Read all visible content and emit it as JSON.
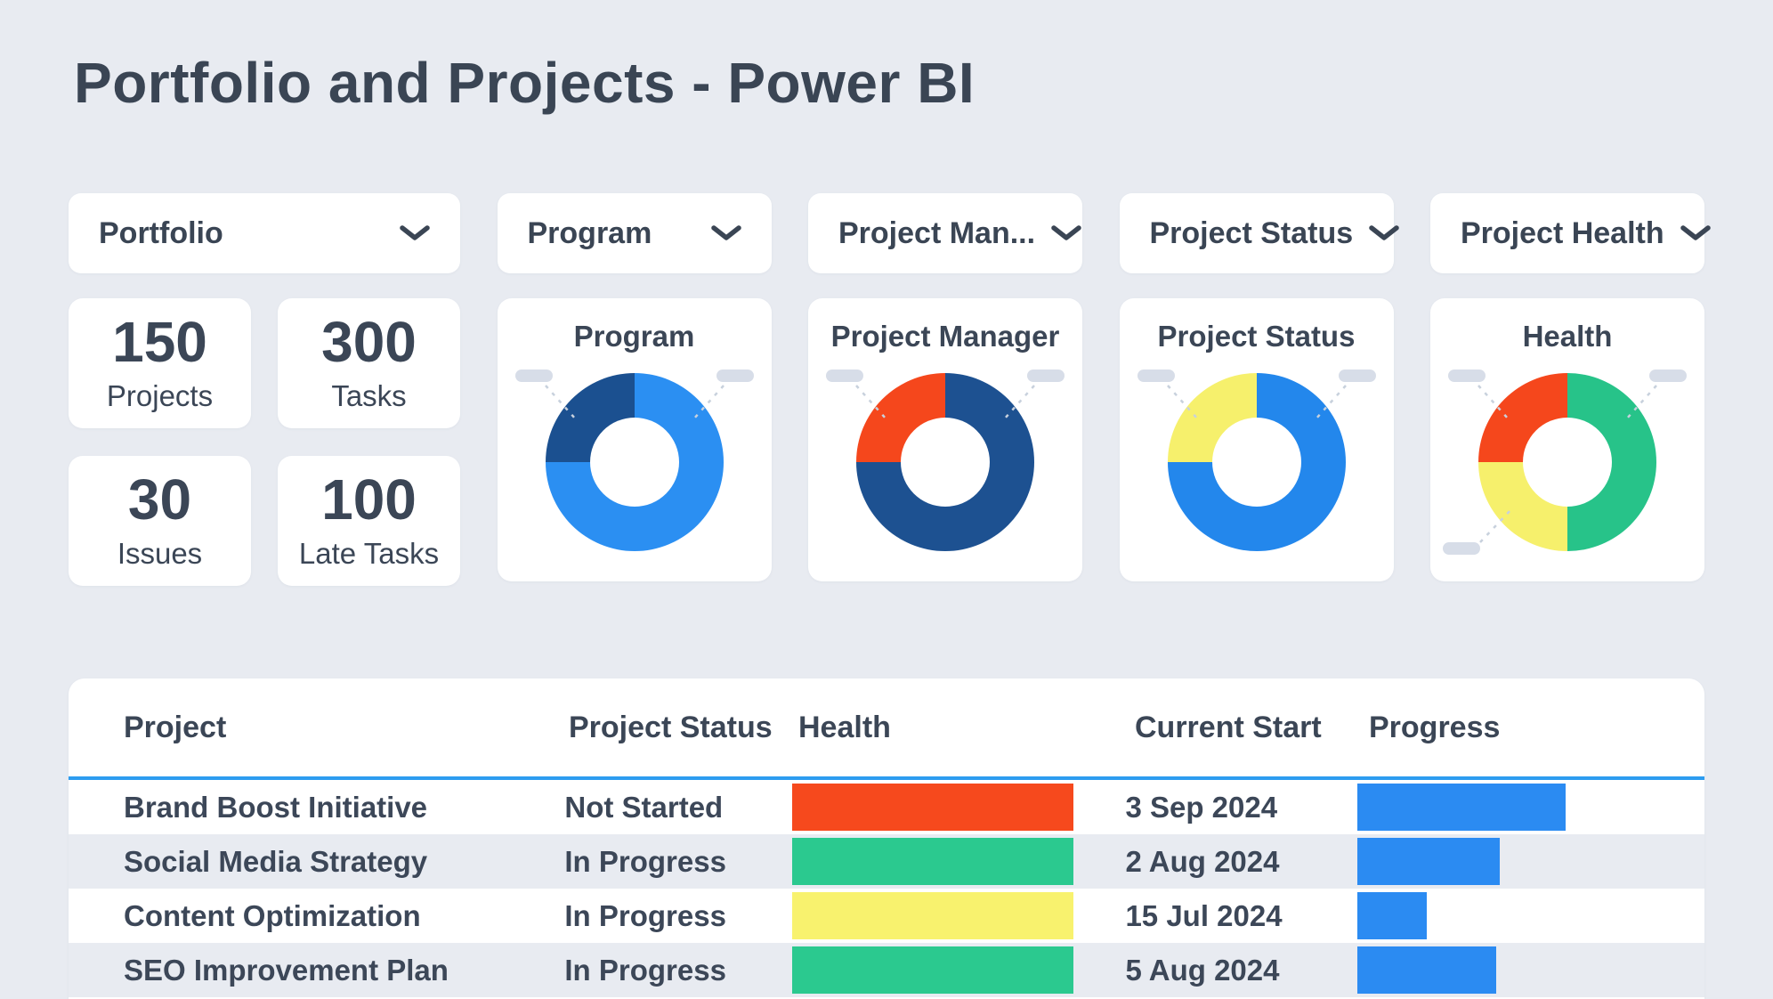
{
  "page": {
    "title": "Portfolio and Projects - Power BI",
    "background": "#E8EBF1"
  },
  "filters": [
    {
      "label": "Portfolio"
    },
    {
      "label": "Program"
    },
    {
      "label": "Project Man..."
    },
    {
      "label": "Project Status"
    },
    {
      "label": "Project Health"
    }
  ],
  "kpis": [
    {
      "value": "150",
      "label": "Projects"
    },
    {
      "value": "300",
      "label": "Tasks"
    },
    {
      "value": "30",
      "label": "Issues"
    },
    {
      "value": "100",
      "label": "Late Tasks"
    }
  ],
  "donuts": [
    {
      "title": "Program",
      "segments": [
        {
          "color": "#2B8FF2",
          "degrees": 270
        },
        {
          "color": "#1B5090",
          "degrees": 90
        }
      ],
      "callouts": [
        "top-left",
        "top-right"
      ]
    },
    {
      "title": "Project Manager",
      "segments": [
        {
          "color": "#1D5191",
          "degrees": 270
        },
        {
          "color": "#F5471C",
          "degrees": 90
        }
      ],
      "callouts": [
        "top-left",
        "top-right"
      ]
    },
    {
      "title": "Project Status",
      "segments": [
        {
          "color": "#2387EC",
          "degrees": 270
        },
        {
          "color": "#F6F06C",
          "degrees": 90
        }
      ],
      "callouts": [
        "top-left",
        "top-right"
      ]
    },
    {
      "title": "Health",
      "segments": [
        {
          "color": "#27C389",
          "degrees": 180
        },
        {
          "color": "#F6F06C",
          "degrees": 90
        },
        {
          "color": "#F5471C",
          "degrees": 90
        }
      ],
      "callouts": [
        "top-left",
        "top-right",
        "bottom-left"
      ]
    }
  ],
  "table": {
    "columns": [
      "Project",
      "Project Status",
      "Health",
      "Current Start",
      "Progress"
    ],
    "divider_color": "#2D9CF0",
    "progress_color": "#2B8BF2",
    "rows": [
      {
        "project": "Brand Boost Initiative",
        "status": "Not Started",
        "health_color": "#F6491D",
        "start": "3 Sep 2024",
        "progress_pct": 60
      },
      {
        "project": "Social Media Strategy",
        "status": "In Progress",
        "health_color": "#2BC98F",
        "start": "2 Aug 2024",
        "progress_pct": 41
      },
      {
        "project": "Content Optimization",
        "status": "In Progress",
        "health_color": "#F8F26E",
        "start": "15 Jul 2024",
        "progress_pct": 20
      },
      {
        "project": "SEO Improvement Plan",
        "status": "In Progress",
        "health_color": "#2BC98F",
        "start": "5 Aug 2024",
        "progress_pct": 40
      }
    ]
  },
  "decor": {
    "callout_pill_color": "#D7DDE8",
    "callout_line_color": "#C8D1DD"
  }
}
